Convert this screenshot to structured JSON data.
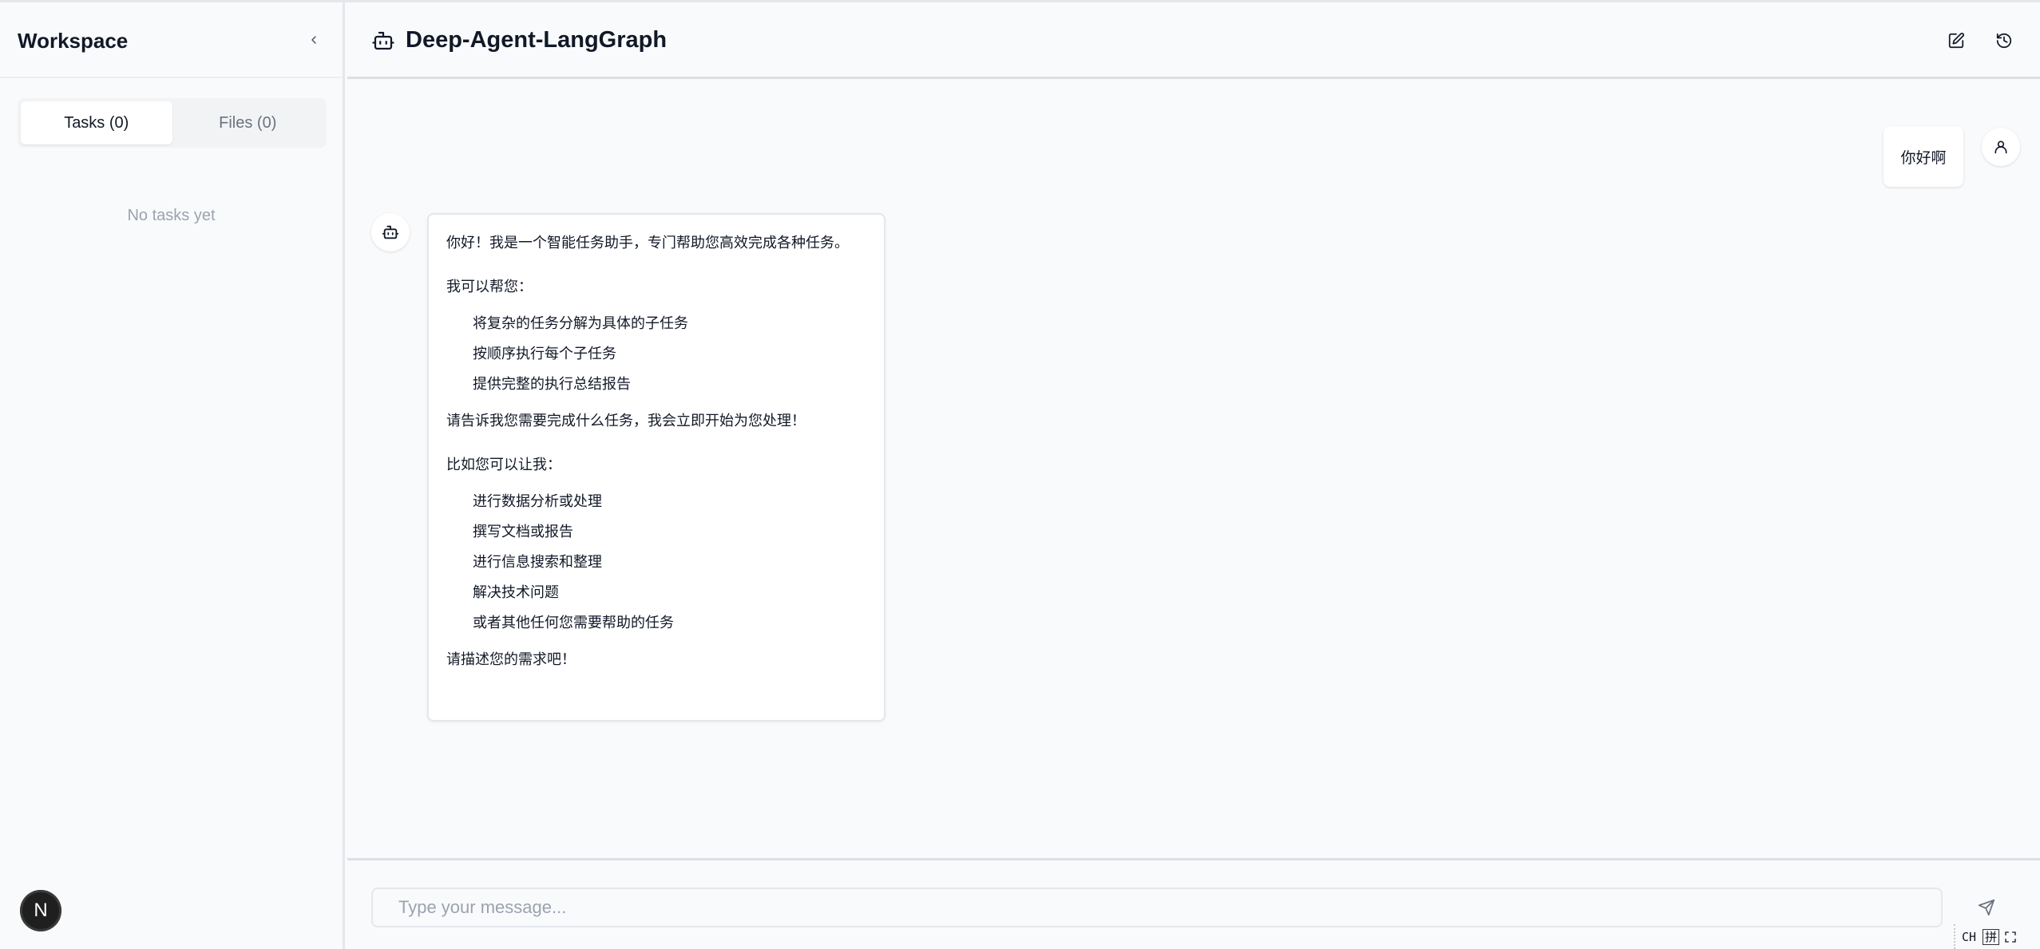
{
  "sidebar": {
    "title": "Workspace",
    "tabs": [
      {
        "label": "Tasks (0)",
        "active": true
      },
      {
        "label": "Files (0)",
        "active": false
      }
    ],
    "empty_message": "No tasks yet",
    "badge": "N"
  },
  "header": {
    "title": "Deep-Agent-LangGraph",
    "icons": [
      "bot-icon",
      "new-chat-icon",
      "history-icon"
    ]
  },
  "messages": {
    "user": {
      "text": "你好啊"
    },
    "assistant": {
      "intro": "你好！我是一个智能任务助手，专门帮助您高效完成各种任务。",
      "can_help": "我可以帮您：",
      "help_items": [
        "将复杂的任务分解为具体的子任务",
        "按顺序执行每个子任务",
        "提供完整的执行总结报告"
      ],
      "prompt": "请告诉我您需要完成什么任务，我会立即开始为您处理！",
      "examples_intro": "比如您可以让我：",
      "examples": [
        "进行数据分析或处理",
        "撰写文档或报告",
        "进行信息搜索和整理",
        "解决技术问题",
        "或者其他任何您需要帮助的任务"
      ],
      "closing": "请描述您的需求吧！"
    }
  },
  "composer": {
    "placeholder": "Type your message...",
    "value": ""
  },
  "ime": {
    "mode": "CH",
    "input": "拼"
  },
  "colors": {
    "background": "#f9fafb",
    "border": "#e5e7eb",
    "text": "#111827",
    "muted": "#9ca3af"
  }
}
